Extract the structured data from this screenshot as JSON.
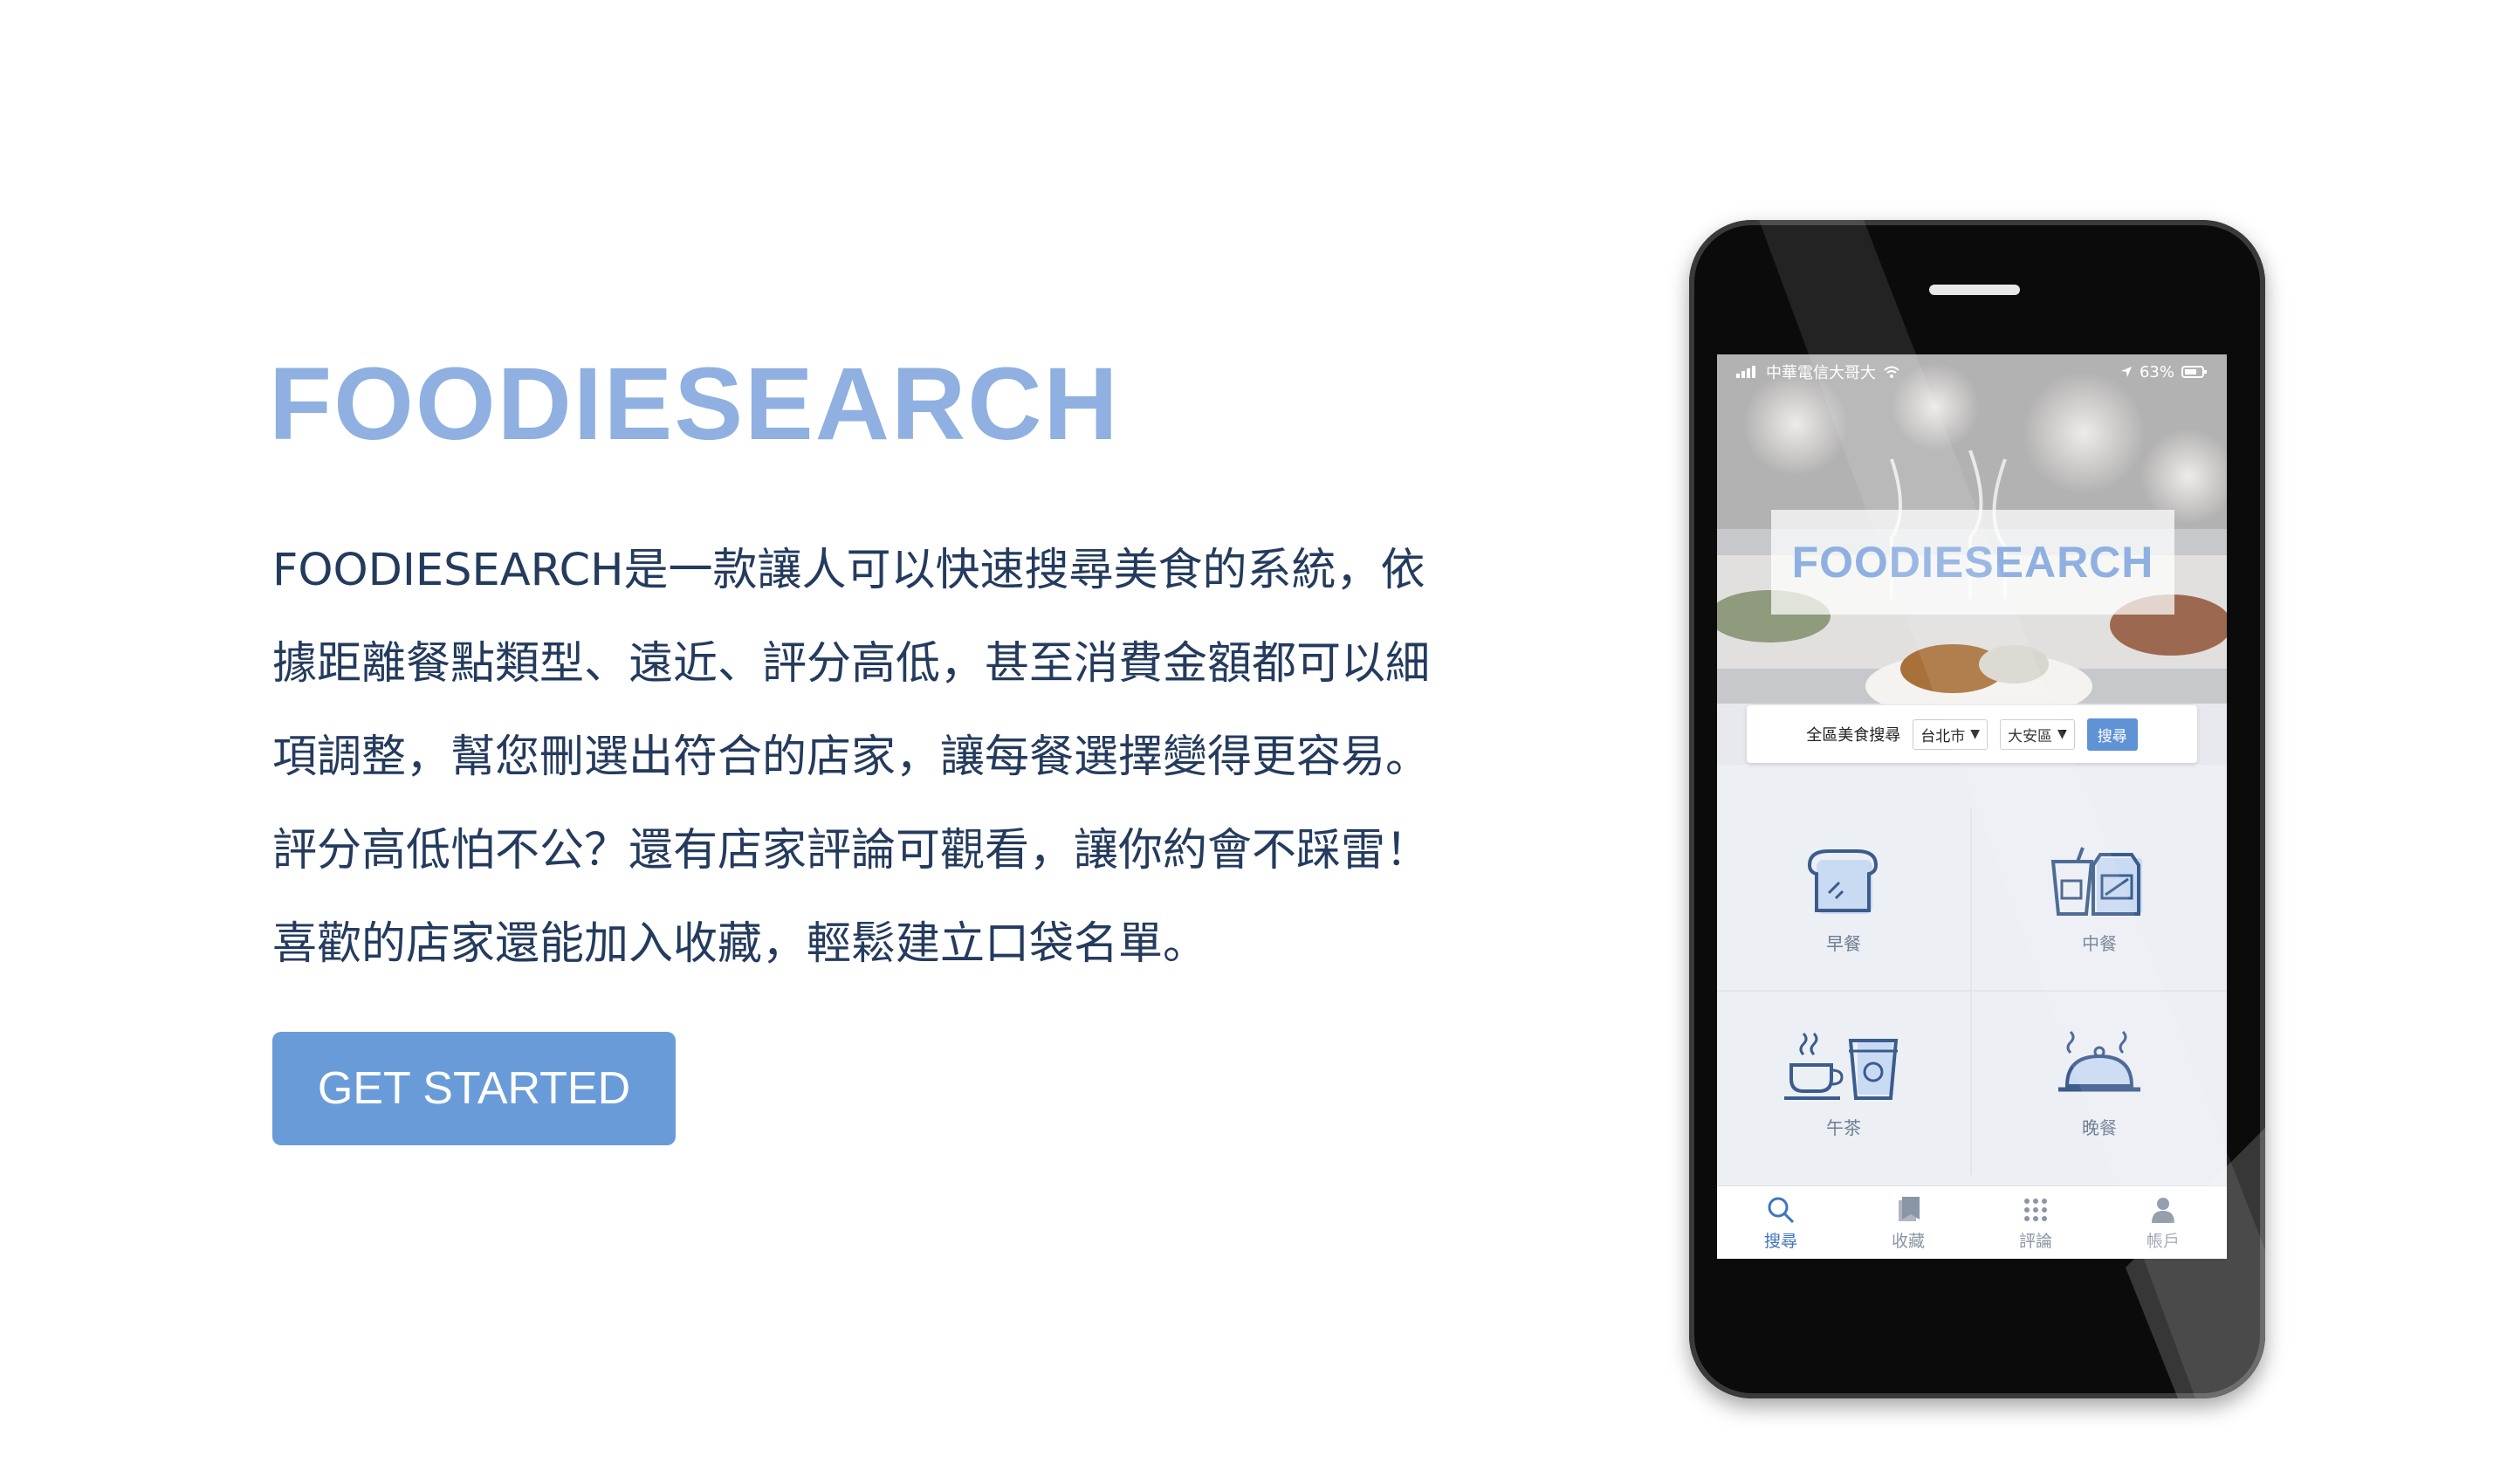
{
  "hero": {
    "title": "FOODIESEARCH",
    "description_lines": [
      "FOODIESEARCH是一款讓人可以快速搜尋美食的系統，依",
      "據距離餐點類型、遠近、評分高低，甚至消費金額都可以細",
      "項調整，幫您刪選出符合的店家，讓每餐選擇變得更容易。",
      "評分高低怕不公？還有店家評論可觀看，讓你約會不踩雷！",
      "喜歡的店家還能加入收藏，輕鬆建立口袋名單。"
    ],
    "cta_label": "GET STARTED"
  },
  "phone": {
    "status": {
      "carrier": "中華電信大哥大",
      "battery": "63%"
    },
    "banner_logo": "FOODIESEARCH",
    "search": {
      "label": "全區美食搜尋",
      "city": "台北市",
      "district": "大安區",
      "button": "搜尋"
    },
    "categories": [
      {
        "label": "早餐",
        "icon": "bread-icon"
      },
      {
        "label": "中餐",
        "icon": "takeout-meal-icon"
      },
      {
        "label": "午茶",
        "icon": "tea-coffee-icon"
      },
      {
        "label": "晚餐",
        "icon": "dinner-cloche-icon"
      }
    ],
    "tabs": [
      {
        "label": "搜尋",
        "icon": "search-icon"
      },
      {
        "label": "收藏",
        "icon": "bookmark-icon"
      },
      {
        "label": "評論",
        "icon": "grid-dots-icon"
      },
      {
        "label": "帳戶",
        "icon": "user-icon"
      }
    ],
    "colors": {
      "accent": "#5f93d6",
      "logo": "#8fb0e0",
      "cta": "#6a9bd9"
    }
  }
}
